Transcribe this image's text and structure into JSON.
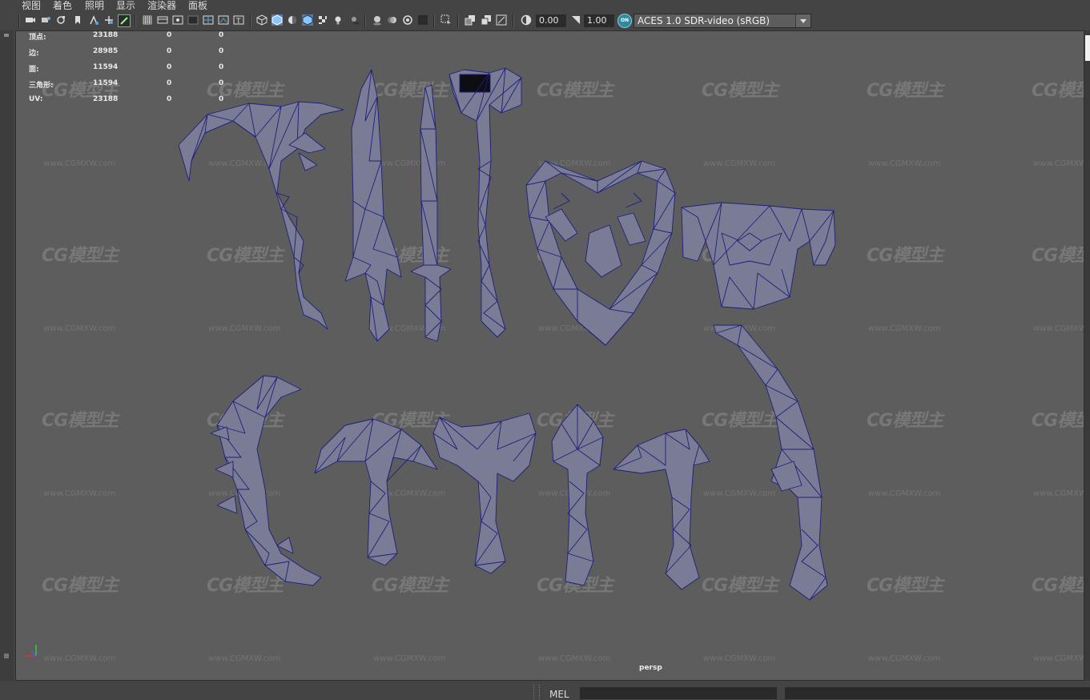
{
  "menu": [
    "视图",
    "着色",
    "照明",
    "显示",
    "渲染器",
    "面板"
  ],
  "toolbar": {
    "exposure": "0.00",
    "gamma": "1.00",
    "color_space": "ACES 1.0 SDR-video (sRGB)",
    "color_mgmt_badge": "ON",
    "icons": [
      "camera-icon",
      "camera-attr-icon",
      "bookmark-icon",
      "image-plane-icon",
      "2d-pan-icon",
      "grease-pencil-icon",
      "grid-icon",
      "film-gate-icon",
      "resolution-gate-icon",
      "gate-mask-icon",
      "field-chart-icon",
      "safe-action-icon",
      "safe-title-icon",
      "wireframe-icon",
      "smooth-shade-icon",
      "default-material-icon",
      "wireframe-on-shaded-icon",
      "textured-icon",
      "lights-icon",
      "shadows-icon",
      "screen-space-ao-icon",
      "motion-blur-icon",
      "multisample-aa-icon",
      "depth-of-field-icon",
      "isolate-select-icon",
      "xray-icon",
      "xray-joints-icon",
      "xray-components-icon",
      "exposure-icon",
      "gamma-icon",
      "color-management-icon"
    ]
  },
  "hud": {
    "rows": [
      {
        "label": "顶点:",
        "v1": "23188",
        "v2": "0",
        "v3": "0"
      },
      {
        "label": "边:",
        "v1": "28985",
        "v2": "0",
        "v3": "0"
      },
      {
        "label": "面:",
        "v1": "11594",
        "v2": "0",
        "v3": "0"
      },
      {
        "label": "三角形:",
        "v1": "11594",
        "v2": "0",
        "v3": "0"
      },
      {
        "label": "UV:",
        "v1": "23188",
        "v2": "0",
        "v3": "0"
      }
    ]
  },
  "viewport": {
    "camera_label": "persp"
  },
  "watermark": {
    "logo": "CG模型主",
    "url": "www.CGMXW.com"
  },
  "command_line": {
    "label": "MEL"
  }
}
